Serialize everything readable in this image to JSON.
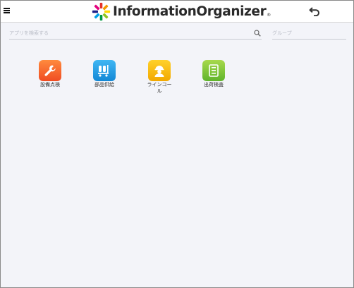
{
  "header": {
    "brand": "InformationOrganizer",
    "brand_mark": "®",
    "icons": {
      "menu": "hamburger-menu-icon",
      "back": "undo-arrow-icon",
      "logo": "colorful-pinwheel-logo"
    }
  },
  "search": {
    "placeholder": "アプリを検索する",
    "value": ""
  },
  "group": {
    "placeholder": "グループ",
    "value": ""
  },
  "apps": [
    {
      "label": "設備点検",
      "icon": "wrench-icon",
      "color": "#f35b2a"
    },
    {
      "label": "部品供給",
      "icon": "cart-icon",
      "color": "#1e94de"
    },
    {
      "label": "ラインコール",
      "icon": "worker-icon",
      "color": "#f5b400"
    },
    {
      "label": "出荷検査",
      "icon": "checklist-icon",
      "color": "#6cbd31"
    }
  ]
}
